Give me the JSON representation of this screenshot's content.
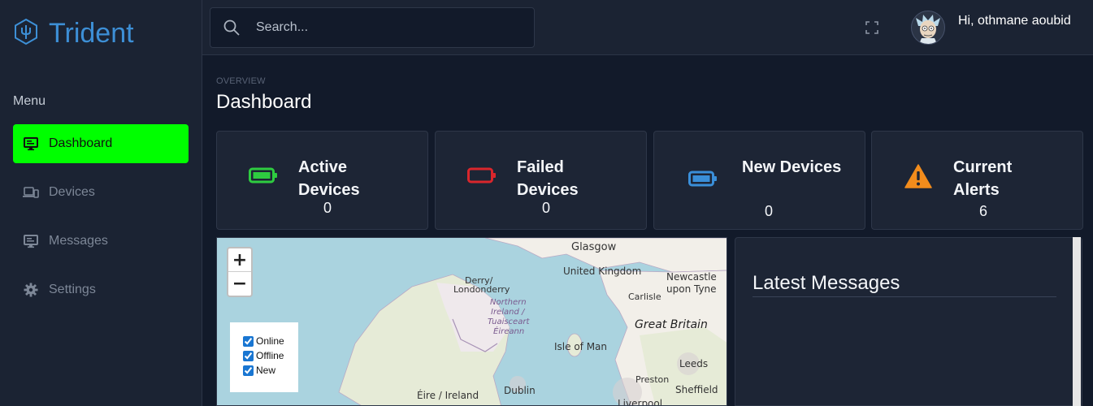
{
  "brand": {
    "name": "Trident"
  },
  "sidebar": {
    "menu_label": "Menu",
    "items": [
      {
        "label": "Dashboard",
        "icon": "monitor-icon",
        "active": true
      },
      {
        "label": "Devices",
        "icon": "devices-icon",
        "active": false
      },
      {
        "label": "Messages",
        "icon": "messages-icon",
        "active": false
      },
      {
        "label": "Settings",
        "icon": "gear-icon",
        "active": false
      }
    ]
  },
  "topbar": {
    "search_placeholder": "Search...",
    "greeting": "Hi, othmane aoubid"
  },
  "page": {
    "breadcrumb": "OVERVIEW",
    "title": "Dashboard"
  },
  "cards": [
    {
      "title": "Active Devices",
      "value": "0",
      "icon": "battery-full-icon",
      "color": "#2ecc40"
    },
    {
      "title": "Failed Devices",
      "value": "0",
      "icon": "battery-empty-icon",
      "color": "#d9262c"
    },
    {
      "title": "New Devices",
      "value": "0",
      "icon": "battery-icon",
      "color": "#3a8fd9"
    },
    {
      "title": "Current Alerts",
      "value": "6",
      "icon": "warning-icon",
      "color": "#f28c1c"
    }
  ],
  "map": {
    "zoom_in": "+",
    "zoom_out": "−",
    "layers": [
      "Online",
      "Offline",
      "New"
    ],
    "labels": {
      "glasgow": "Glasgow",
      "uk": "United Kingdom",
      "newcastle1": "Newcastle",
      "newcastle2": "upon Tyne",
      "derry1": "Derry/",
      "derry2": "Londonderry",
      "ni1": "Northern",
      "ni2": "Ireland /",
      "ni3": "Tuaisceart",
      "ni4": "Éireann",
      "carlisle": "Carlisle",
      "gb": "Great Britain",
      "iom": "Isle of Man",
      "leeds": "Leeds",
      "preston": "Preston",
      "sheffield": "Sheffield",
      "ireland": "Éire / Ireland",
      "dublin": "Dublin",
      "liverpool": "Liverpool"
    }
  },
  "messages_panel": {
    "title": "Latest Messages"
  },
  "colors": {
    "accent": "#3d8fd6",
    "active_nav": "#00ff00"
  }
}
